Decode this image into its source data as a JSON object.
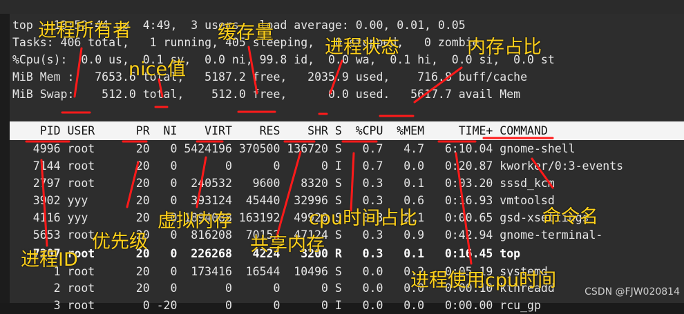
{
  "summary": {
    "l1": "top - 13:52:44 up  4:49,  3 users,  load average: 0.00, 0.01, 0.05",
    "l2": "Tasks: 406 total,   1 running, 405 sleeping,   0 stopped,   0 zombie",
    "l3": "%Cpu(s):  0.0 us,  0.1 sy,  0.0 ni, 99.8 id,  0.0 wa,  0.1 hi,  0.0 si,  0.0 st",
    "l4": "MiB Mem :   7653.6 total,   5187.2 free,   2035.9 used,    716.8 buff/cache",
    "l5": "MiB Swap:    512.0 total,    512.0 free,      0.0 used.   5617.7 avail Mem"
  },
  "table": {
    "header": "    PID USER      PR  NI    VIRT    RES    SHR S  %CPU  %MEM     TIME+ COMMAND",
    "rows": [
      "   4996 root      20   0 5424196 370500 136720 S   0.7   4.7   6:10.04 gnome-shell",
      "   7144 root      20   0       0      0      0 I   0.7   0.0   0:20.87 kworker/0:3-events",
      "   2797 root      20   0  240532   9600   8320 S   0.3   0.1   0:03.20 sssd_kcm",
      "   3902 yyy       20   0  393124  45440  32996 S   0.3   0.6   0:16.93 vmtoolsd",
      "   4116 yyy       20   0 1894088 163192  49920 S   0.3   2.1   0:00.65 gsd-xsettings",
      "   5653 root      20   0  816208  70152  47124 S   0.3   0.9   0:42.94 gnome-terminal-",
      "   7207 root      20   0  226268   4224   3200 R   0.3   0.1   0:16.45 top",
      "      1 root      20   0  173416  16544  10496 S   0.0   0.2   0:05.19 systemd",
      "      2 root      20   0       0      0      0 S   0.0   0.0   0:00.10 kthreadd",
      "      3 root       0 -20       0      0      0 I   0.0   0.0   0:00.00 rcu_gp"
    ]
  },
  "annotations": {
    "owner": "进程所有者",
    "buffer": "缓存量",
    "state": "进程状态",
    "mem_ratio": "内存占比",
    "nice": "nice值",
    "virt": "虚拟内存",
    "cpu_ratio": "cpu时间占比",
    "cmd": "命令名",
    "priority": "优先级",
    "shared": "共享内存",
    "pid": "进程ID",
    "cpu_time": "进程使用cpu时间"
  },
  "watermark": "CSDN @FJW020814",
  "colors": {
    "annotation": "#ffd11a",
    "underline": "#ff1a1a",
    "terminal_bg": "#2d2d2d"
  }
}
